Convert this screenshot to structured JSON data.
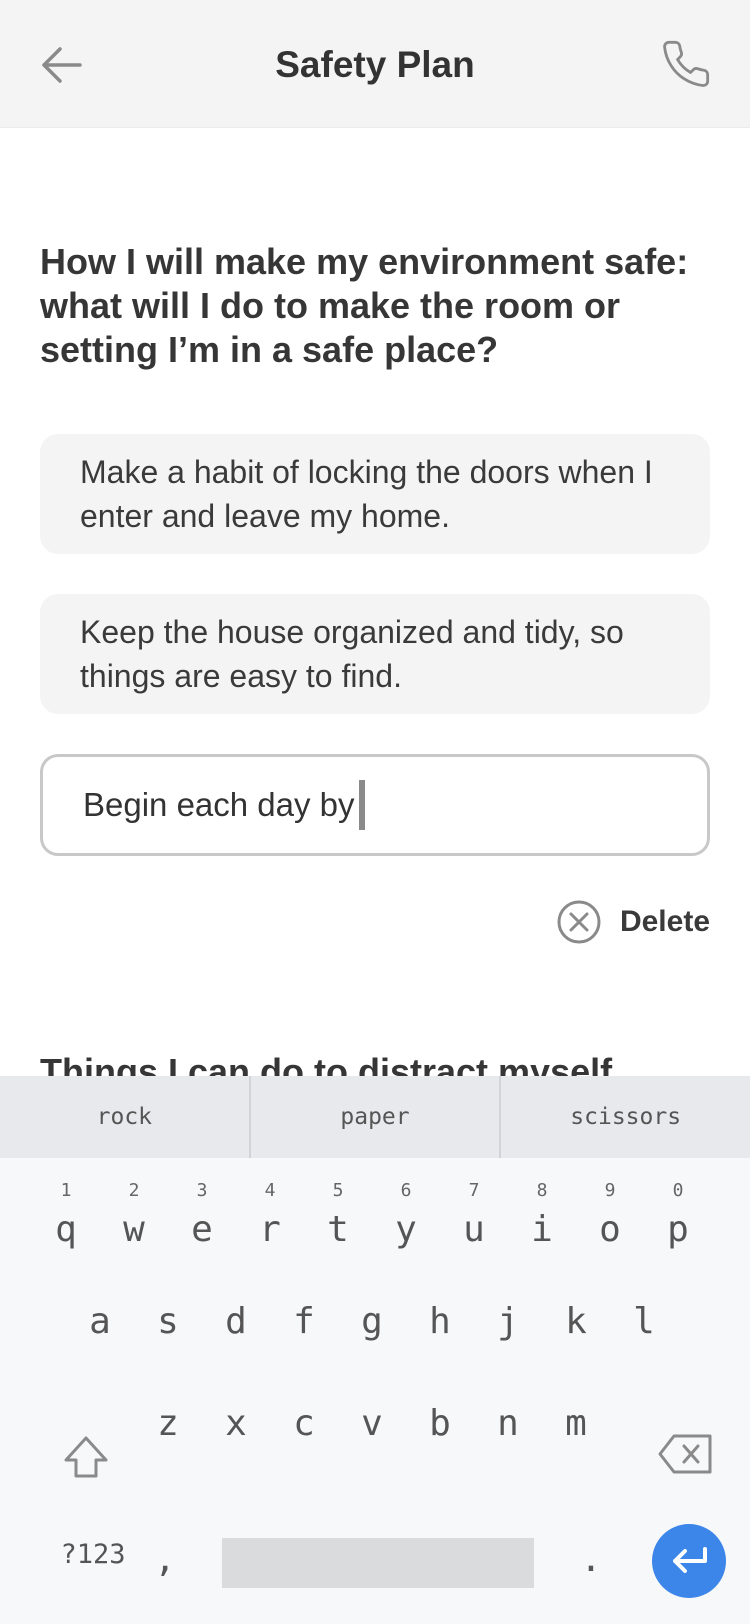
{
  "header": {
    "title": "Safety Plan",
    "back_icon": "arrow-left-icon",
    "call_icon": "phone-icon"
  },
  "section": {
    "question": "How I will make my environment safe: what will I do to make the room or setting I’m in a safe place?",
    "entries": [
      "Make a habit of locking the doors when I enter and leave my home.",
      "Keep the house organized and tidy, so things are easy to find."
    ],
    "input_value": "Begin each day by",
    "delete_label": "Delete",
    "next_heading": "Things I can do to distract myself"
  },
  "keyboard": {
    "suggestions": [
      "rock",
      "paper",
      "scissors"
    ],
    "row1": [
      "q",
      "w",
      "e",
      "r",
      "t",
      "y",
      "u",
      "i",
      "o",
      "p"
    ],
    "row1_hints": [
      "1",
      "2",
      "3",
      "4",
      "5",
      "6",
      "7",
      "8",
      "9",
      "0"
    ],
    "row2": [
      "a",
      "s",
      "d",
      "f",
      "g",
      "h",
      "j",
      "k",
      "l"
    ],
    "row3": [
      "z",
      "x",
      "c",
      "v",
      "b",
      "n",
      "m"
    ],
    "symbols_label": "?123",
    "comma": ",",
    "period": ".",
    "enter_color": "#3b86e8"
  }
}
